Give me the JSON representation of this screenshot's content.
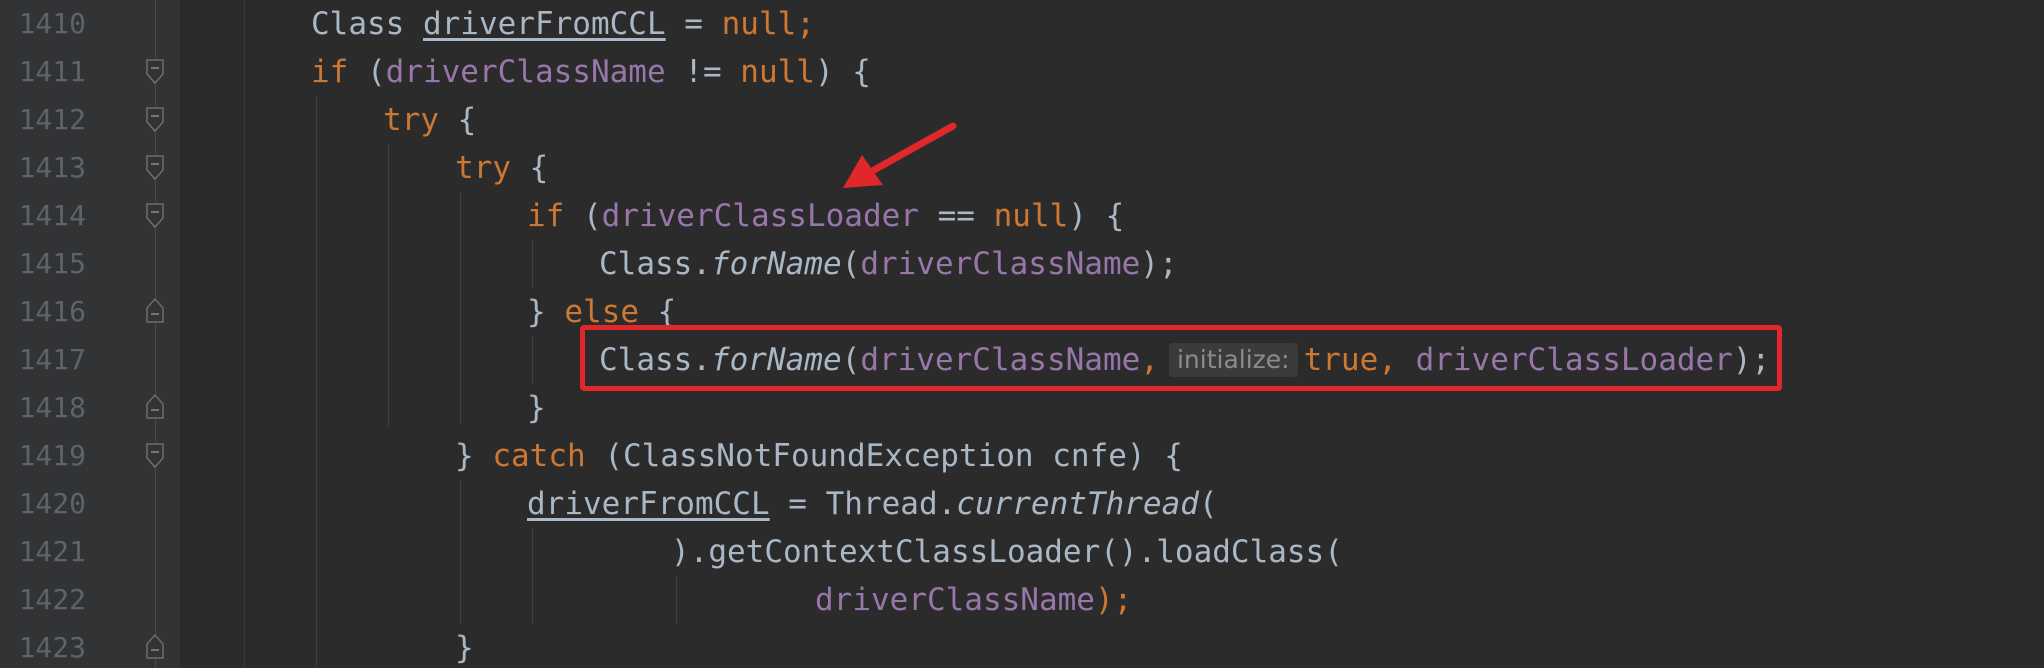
{
  "editor": {
    "colors": {
      "background": "#2b2b2b",
      "gutter_background": "#313335",
      "line_number": "#606366",
      "keyword": "#cc7832",
      "identifier": "#a9b7c6",
      "field": "#9876aa",
      "annotation_red": "#e0282a"
    },
    "line_numbers": [
      "1410",
      "1411",
      "1412",
      "1413",
      "1414",
      "1415",
      "1416",
      "1417",
      "1418",
      "1419",
      "1420",
      "1421",
      "1422",
      "1423"
    ],
    "lines": {
      "l1410": {
        "t1": "Class ",
        "t2": "driverFromCCL",
        "t3": " = ",
        "t4": "null",
        "t5": ";"
      },
      "l1411": {
        "t1": "if",
        "t2": " (",
        "t3": "driverClassName",
        "t4": " != ",
        "t5": "null",
        "t6": ") {"
      },
      "l1412": {
        "t1": "try",
        "t2": " {"
      },
      "l1413": {
        "t1": "try",
        "t2": " {"
      },
      "l1414": {
        "t1": "if",
        "t2": " (",
        "t3": "driverClassLoader",
        "t4": " == ",
        "t5": "null",
        "t6": ") {"
      },
      "l1415": {
        "t1": "Class.",
        "t2": "forName",
        "t3": "(",
        "t4": "driverClassName",
        "t5": ");"
      },
      "l1416": {
        "t1": "} ",
        "t2": "else",
        "t3": " {"
      },
      "l1417": {
        "t1": "Class.",
        "t2": "forName",
        "t3": "(",
        "t4": "driverClassName",
        "t5": ",",
        "hint": "initialize:",
        "t6": "true",
        "t7": ", ",
        "t8": "driverClassLoader",
        "t9": ");"
      },
      "l1418": {
        "t1": "}"
      },
      "l1419": {
        "t1": "} ",
        "t2": "catch",
        "t3": " (ClassNotFoundException cnfe) {"
      },
      "l1420": {
        "t1": "driverFromCCL",
        "t2": " = Thread.",
        "t3": "currentThread",
        "t4": "("
      },
      "l1421": {
        "t1": ").getContextClassLoader().loadClass("
      },
      "l1422": {
        "t1": "driverClassName",
        "t2": ");"
      },
      "l1423": {
        "t1": "}"
      }
    },
    "fold_markers": [
      {
        "line": "1411",
        "kind": "fold-start"
      },
      {
        "line": "1412",
        "kind": "fold-start"
      },
      {
        "line": "1413",
        "kind": "fold-start"
      },
      {
        "line": "1414",
        "kind": "fold-start"
      },
      {
        "line": "1416",
        "kind": "fold-end"
      },
      {
        "line": "1418",
        "kind": "fold-end"
      },
      {
        "line": "1419",
        "kind": "fold-start"
      },
      {
        "line": "1423",
        "kind": "fold-end"
      }
    ]
  }
}
